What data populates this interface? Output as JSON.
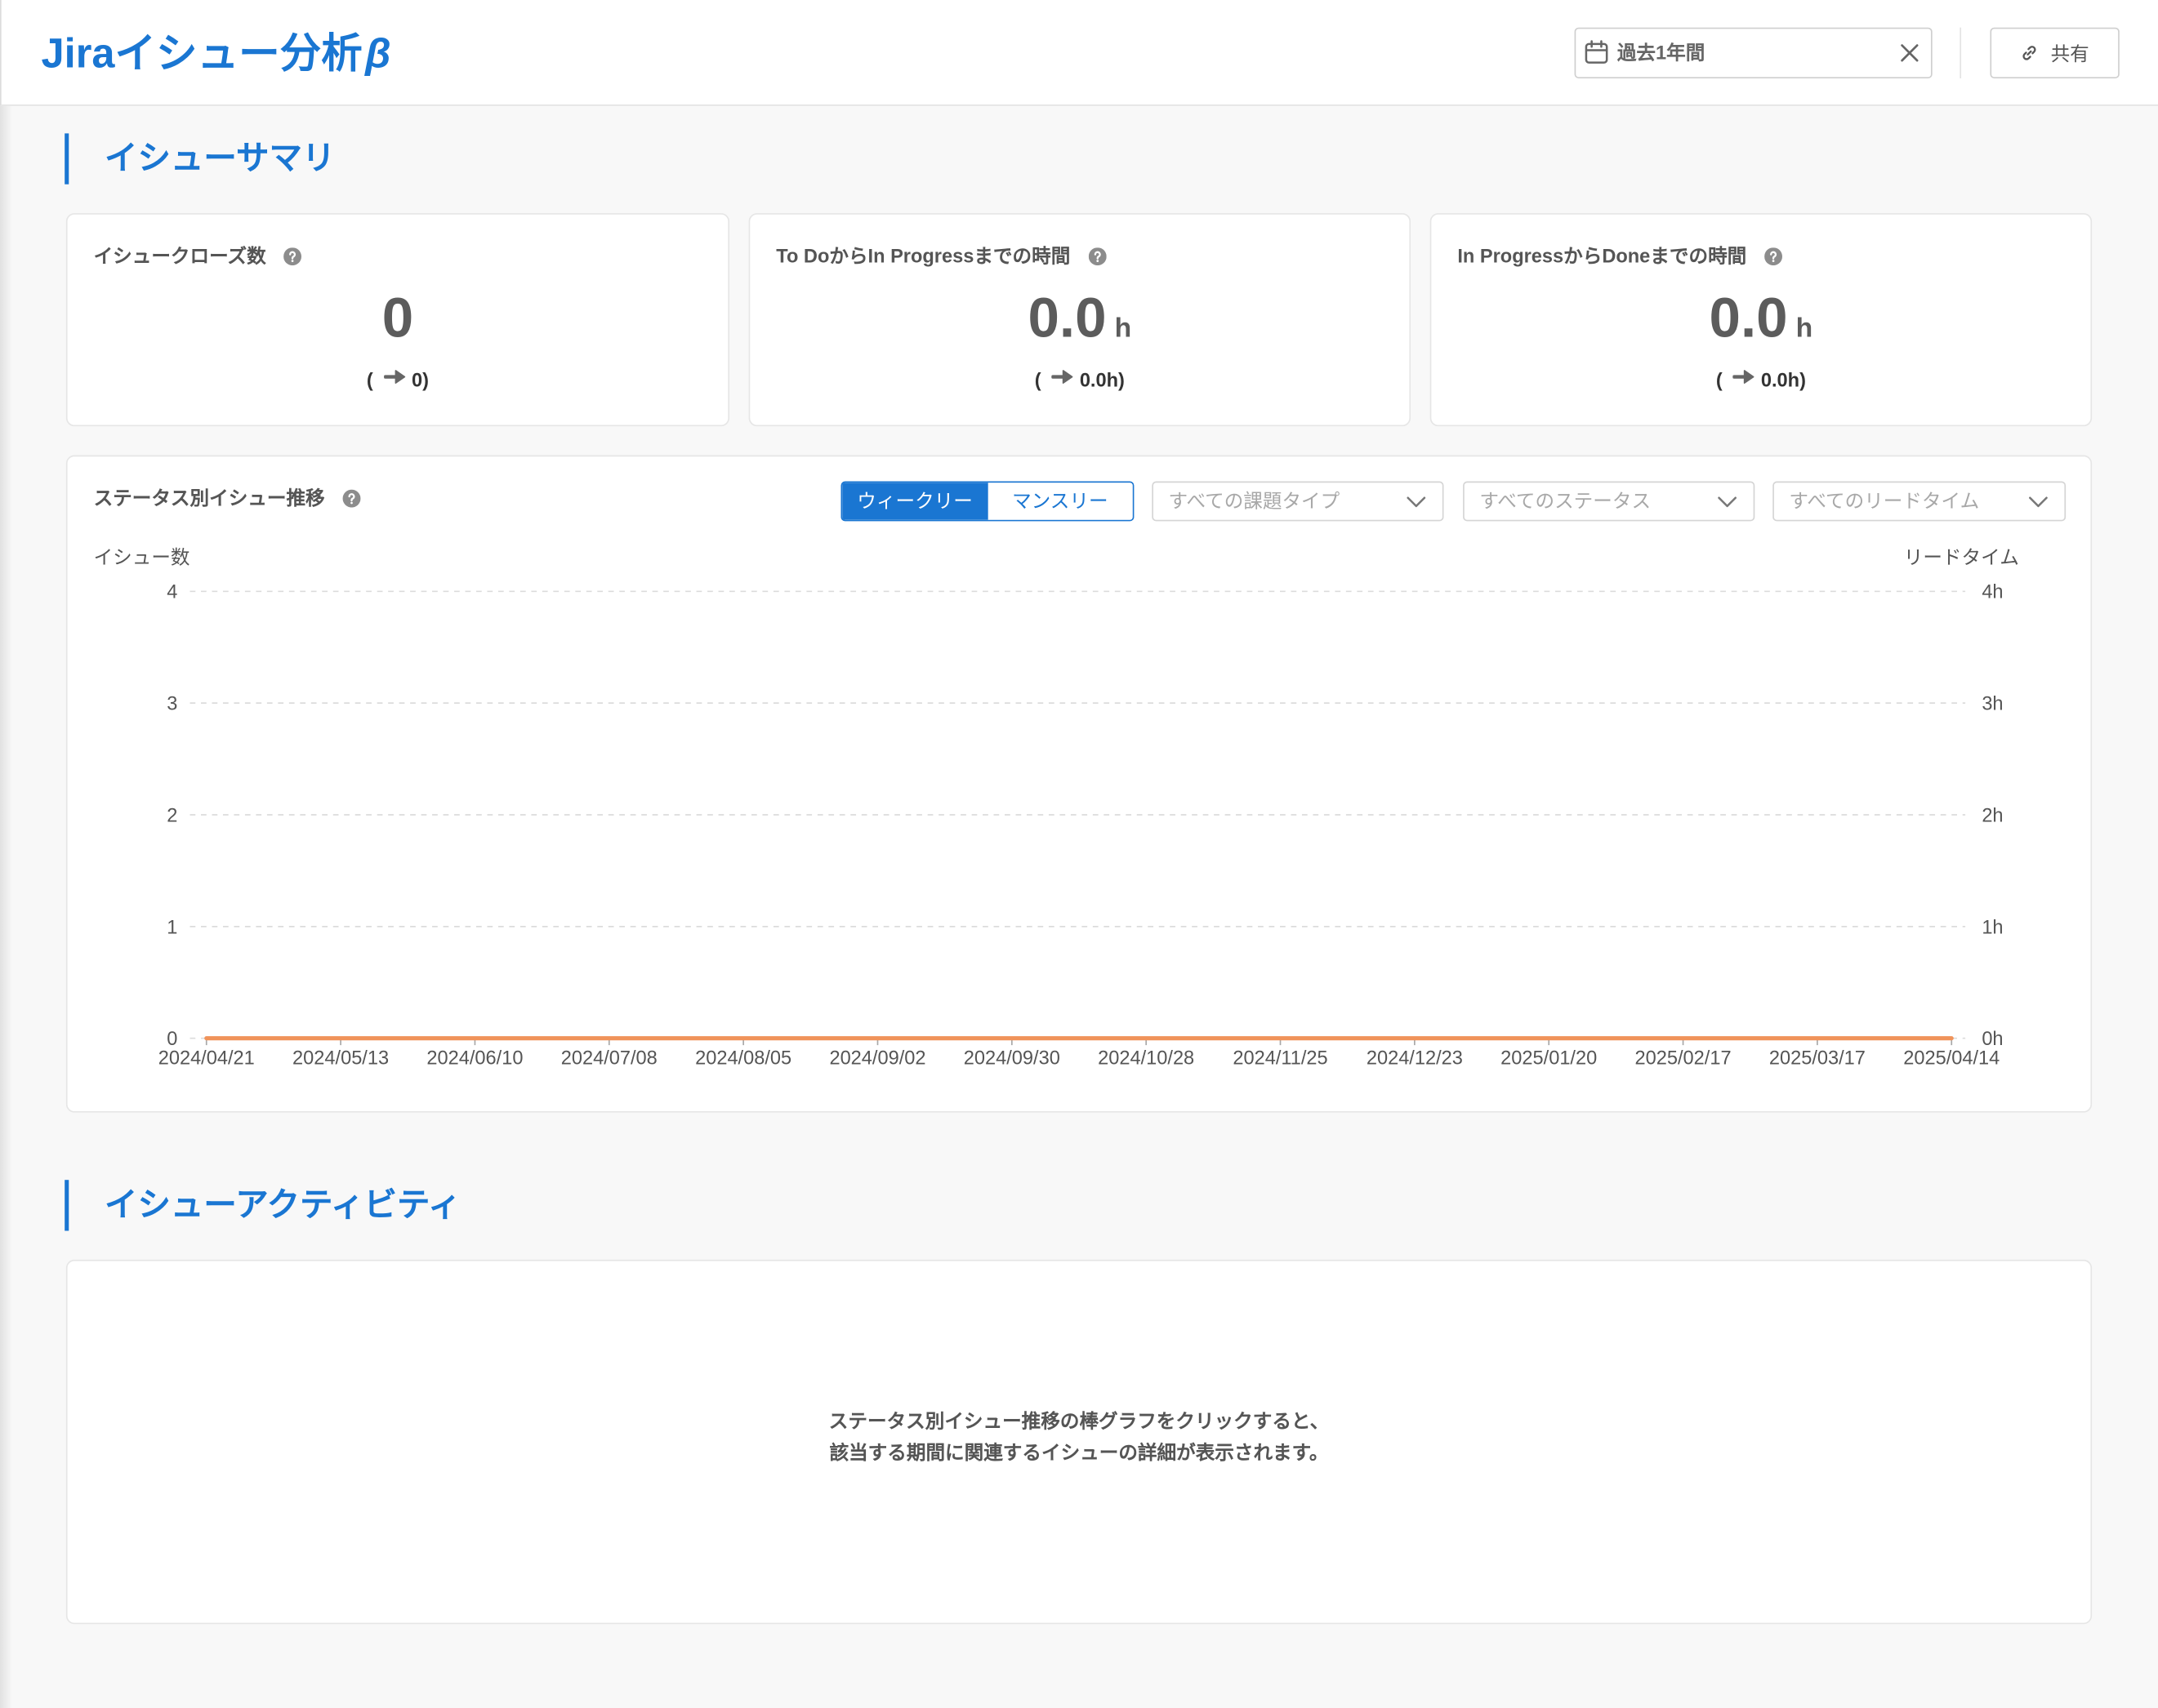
{
  "colors": {
    "accent": "#1a76d2",
    "lead_time_line": "#f0935a"
  },
  "header": {
    "title": "Jiraイシュー分析",
    "title_badge": "β",
    "date_range": {
      "value": "過去1年間",
      "icon": "calendar-icon",
      "clear_icon": "close-icon"
    },
    "share": {
      "label": "共有",
      "icon": "link-icon"
    }
  },
  "summary": {
    "section_title": "イシューサマリ",
    "cards": [
      {
        "label": "イシュークローズ数",
        "value": "0",
        "delta_open": "(",
        "delta": "0",
        "delta_close": ")"
      },
      {
        "label": "To DoからIn Progressまでの時間",
        "value": "0.0",
        "unit": "h",
        "delta_open": "(",
        "delta": "0.0h",
        "delta_close": ")"
      },
      {
        "label": "In ProgressからDoneまでの時間",
        "value": "0.0",
        "unit": "h",
        "delta_open": "(",
        "delta": "0.0h",
        "delta_close": ")"
      }
    ]
  },
  "trend": {
    "period_toggle": {
      "options": [
        "ウィークリー",
        "マンスリー"
      ],
      "selected_index": 0
    },
    "filters": [
      {
        "placeholder": "すべての課題タイプ"
      },
      {
        "placeholder": "すべてのステータス"
      },
      {
        "placeholder": "すべてのリードタイム"
      }
    ]
  },
  "chart_data": {
    "type": "line",
    "title": "ステータス別イシュー推移",
    "x": [
      "2024/04/21",
      "2024/05/13",
      "2024/06/10",
      "2024/07/08",
      "2024/08/05",
      "2024/09/02",
      "2024/09/30",
      "2024/10/28",
      "2024/11/25",
      "2024/12/23",
      "2025/01/20",
      "2025/02/17",
      "2025/03/17",
      "2025/04/14"
    ],
    "series": [
      {
        "axis": "y2",
        "color": "#f0935a",
        "values": [
          0,
          0,
          0,
          0,
          0,
          0,
          0,
          0,
          0,
          0,
          0,
          0,
          0,
          0
        ]
      }
    ],
    "ylabel": "イシュー数",
    "y2label": "リードタイム",
    "ylim": [
      0,
      4
    ],
    "y2lim": [
      0,
      4
    ],
    "yticks": [
      0,
      1,
      2,
      3,
      4
    ],
    "y2ticks": [
      "0h",
      "1h",
      "2h",
      "3h",
      "4h"
    ],
    "grid": true
  },
  "activity": {
    "section_title": "イシューアクティビティ",
    "empty_message": [
      "ステータス別イシュー推移の棒グラフをクリックすると、",
      "該当する期間に関連するイシューの詳細が表示されます。"
    ]
  }
}
